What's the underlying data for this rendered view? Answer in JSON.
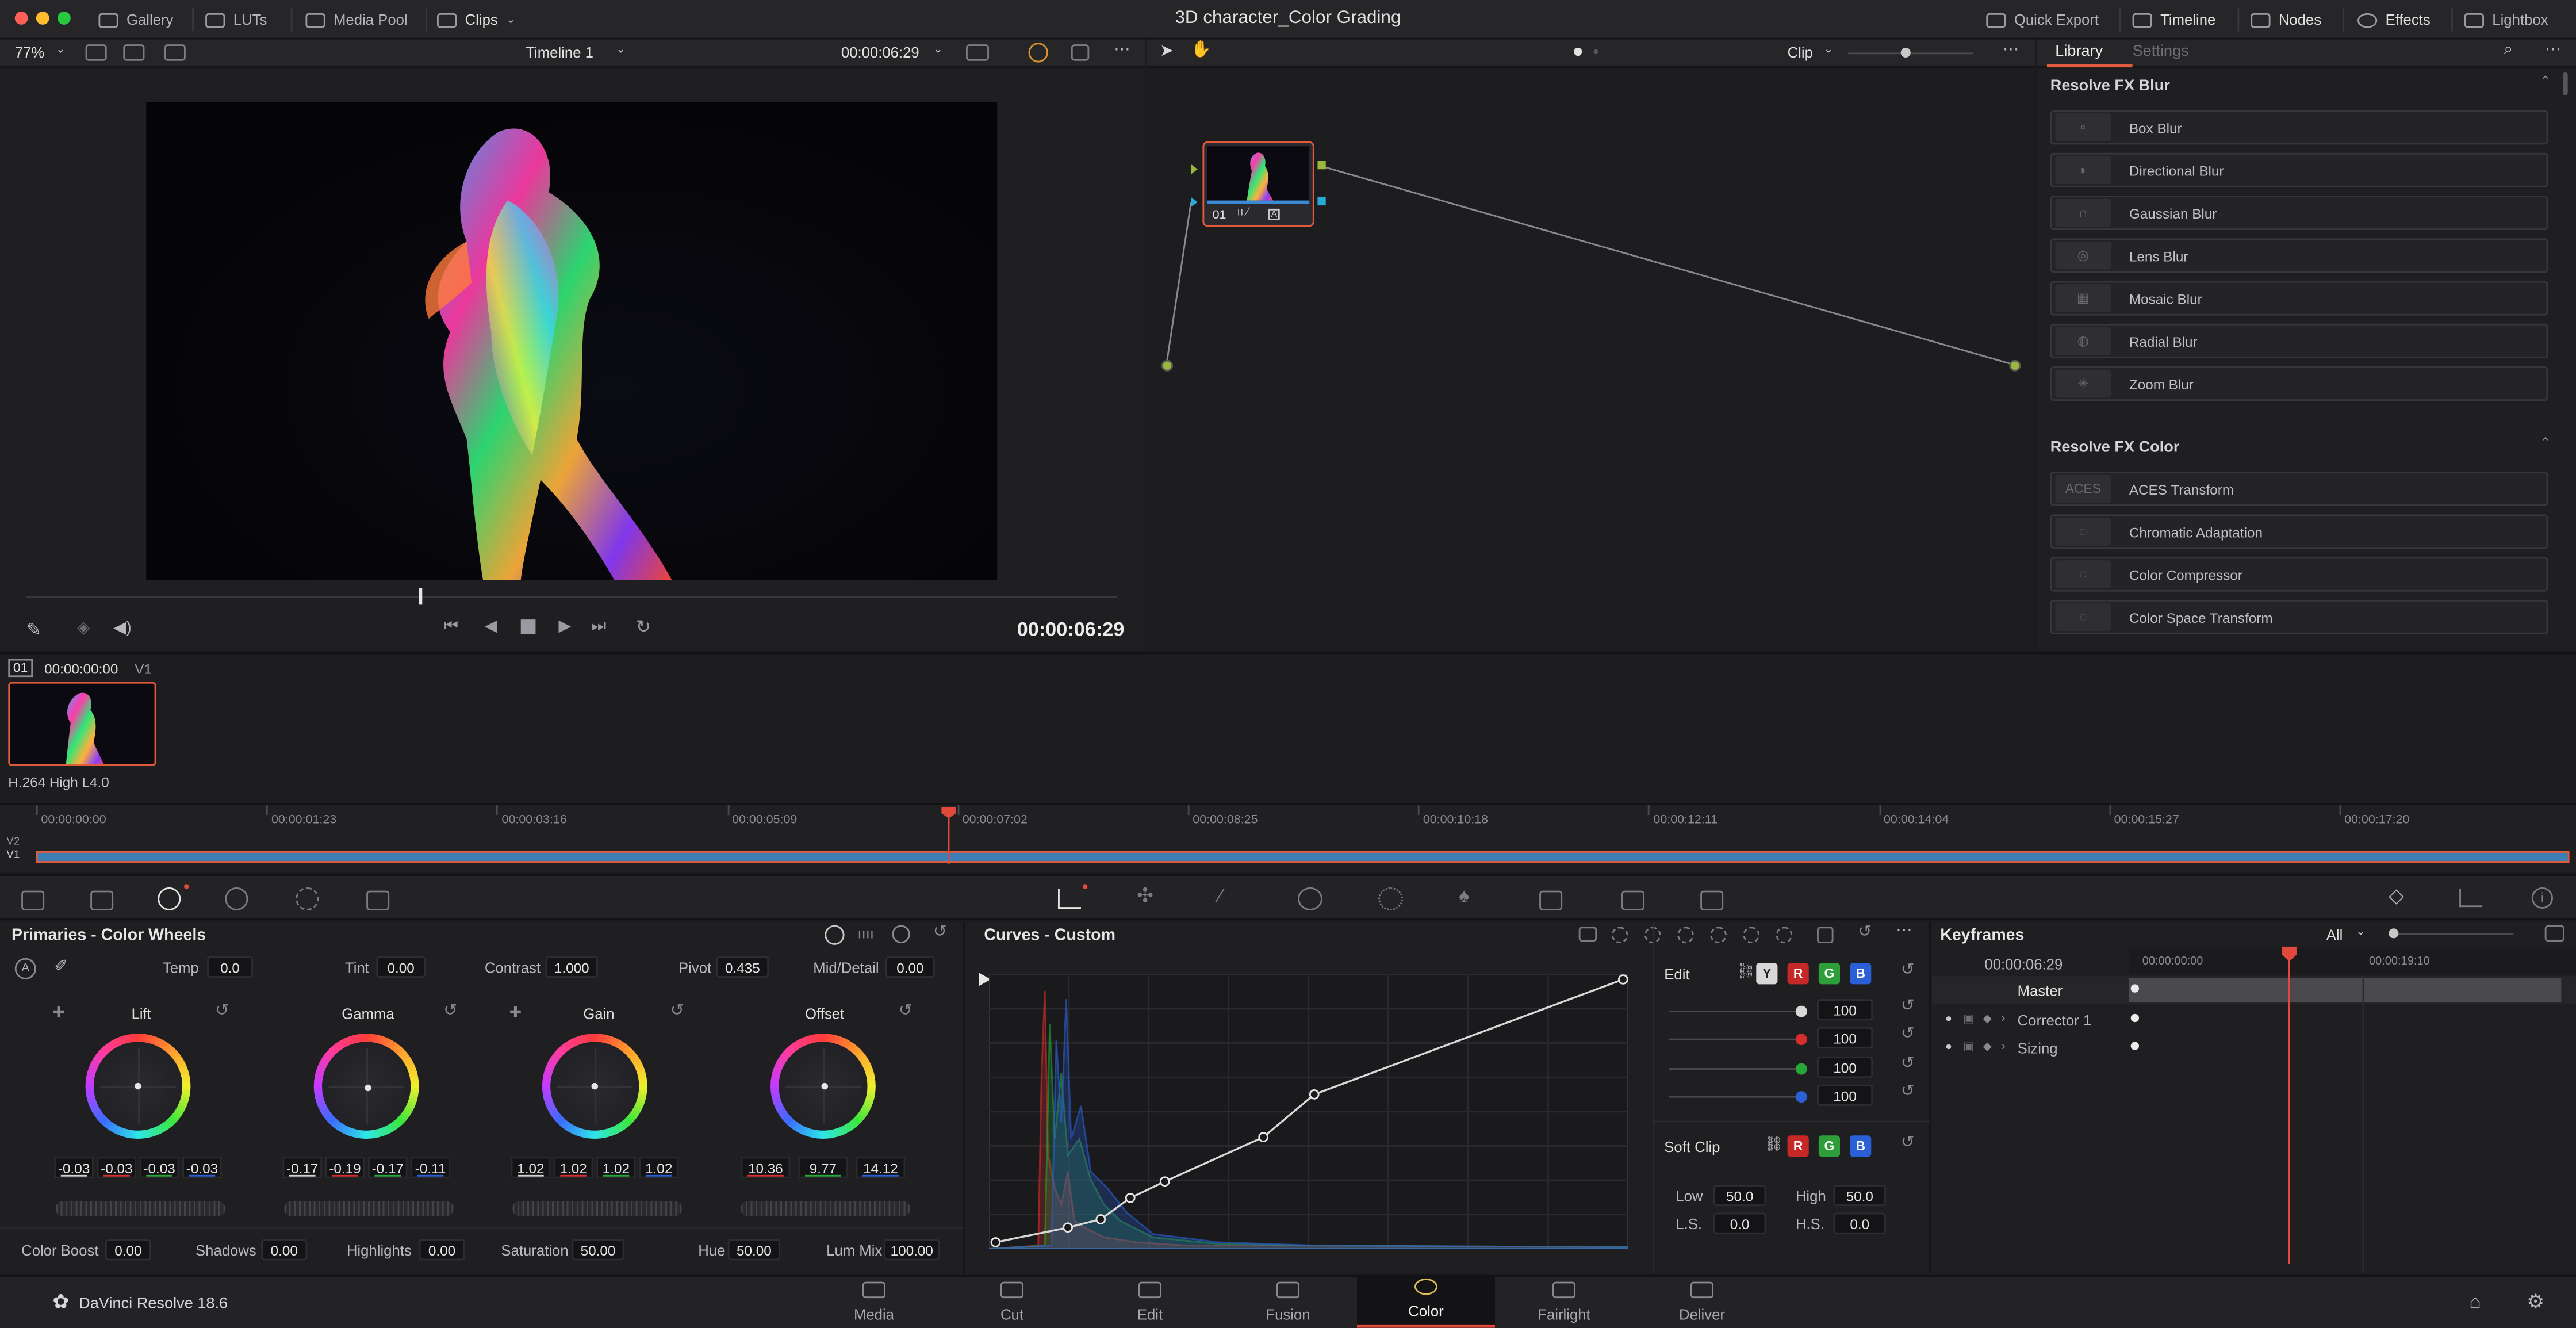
{
  "titlebar": {
    "title": "3D character_Color Grading",
    "left_items": [
      "Gallery",
      "LUTs",
      "Media Pool",
      "Clips"
    ],
    "right_items": [
      "Quick Export",
      "Timeline",
      "Nodes",
      "Effects",
      "Lightbox"
    ]
  },
  "viewer": {
    "zoom": "77%",
    "timeline_name": "Timeline 1",
    "timecode_top": "00:00:06:29",
    "timecode_bottom": "00:00:06:29"
  },
  "node_editor": {
    "mode": "Clip",
    "node_label": "01"
  },
  "effects_panel": {
    "tabs": [
      "Library",
      "Settings"
    ],
    "sections": [
      {
        "title": "Resolve FX Blur",
        "items": [
          "Box Blur",
          "Directional Blur",
          "Gaussian Blur",
          "Lens Blur",
          "Mosaic Blur",
          "Radial Blur",
          "Zoom Blur"
        ]
      },
      {
        "title": "Resolve FX Color",
        "items": [
          "ACES Transform",
          "Chromatic Adaptation",
          "Color Compressor",
          "Color Space Transform"
        ]
      }
    ],
    "aces_thumb_text": "ACES"
  },
  "clip_strip": {
    "clip_number": "01",
    "clip_timecode": "00:00:00:00",
    "track": "V1",
    "codec": "H.264 High L4.0"
  },
  "mini_timeline": {
    "ticks": [
      "00:00:00:00",
      "00:00:01:23",
      "00:00:03:16",
      "00:00:05:09",
      "00:00:07:02",
      "00:00:08:25",
      "00:00:10:18",
      "00:00:12:11",
      "00:00:14:04",
      "00:00:15:27",
      "00:00:17:20"
    ],
    "tracks": [
      "V2",
      "V1"
    ]
  },
  "primaries": {
    "title": "Primaries - Color Wheels",
    "top_params": [
      {
        "label": "Temp",
        "value": "0.0"
      },
      {
        "label": "Tint",
        "value": "0.00"
      },
      {
        "label": "Contrast",
        "value": "1.000"
      },
      {
        "label": "Pivot",
        "value": "0.435"
      },
      {
        "label": "Mid/Detail",
        "value": "0.00"
      }
    ],
    "auto_label": "A",
    "wheels": [
      {
        "name": "Lift",
        "values": [
          "-0.03",
          "-0.03",
          "-0.03",
          "-0.03"
        ]
      },
      {
        "name": "Gamma",
        "values": [
          "-0.17",
          "-0.19",
          "-0.17",
          "-0.11"
        ]
      },
      {
        "name": "Gain",
        "values": [
          "1.02",
          "1.02",
          "1.02",
          "1.02"
        ]
      },
      {
        "name": "Offset",
        "values": [
          "10.36",
          "9.77",
          "14.12"
        ]
      }
    ],
    "bottom_params": [
      {
        "label": "Color Boost",
        "value": "0.00"
      },
      {
        "label": "Shadows",
        "value": "0.00"
      },
      {
        "label": "Highlights",
        "value": "0.00"
      },
      {
        "label": "Saturation",
        "value": "50.00"
      },
      {
        "label": "Hue",
        "value": "50.00"
      },
      {
        "label": "Lum Mix",
        "value": "100.00"
      }
    ]
  },
  "curves": {
    "title": "Curves - Custom",
    "edit_label": "Edit",
    "channels": [
      "Y",
      "R",
      "G",
      "B"
    ],
    "intensity": [
      "100",
      "100",
      "100",
      "100"
    ],
    "soft_clip": {
      "label": "Soft Clip",
      "channels": [
        "R",
        "G",
        "B"
      ],
      "low_label": "Low",
      "low": "50.0",
      "high_label": "High",
      "high": "50.0",
      "ls_label": "L.S.",
      "ls": "0.0",
      "hs_label": "H.S.",
      "hs": "0.0"
    },
    "colors": {
      "red": "#d62d2d",
      "green": "#25a836",
      "blue": "#2a5fd6",
      "y": "#d0d0d0"
    }
  },
  "keyframes": {
    "title": "Keyframes",
    "filter": "All",
    "timecode": "00:00:06:29",
    "ruler": [
      "00:00:00:00",
      "00:00:19:10"
    ],
    "rows": [
      "Master",
      "Corrector 1",
      "Sizing"
    ]
  },
  "bottom_bar": {
    "app": "DaVinci Resolve 18.6",
    "pages": [
      "Media",
      "Cut",
      "Edit",
      "Fusion",
      "Color",
      "Fairlight",
      "Deliver"
    ],
    "active_page": "Color"
  }
}
